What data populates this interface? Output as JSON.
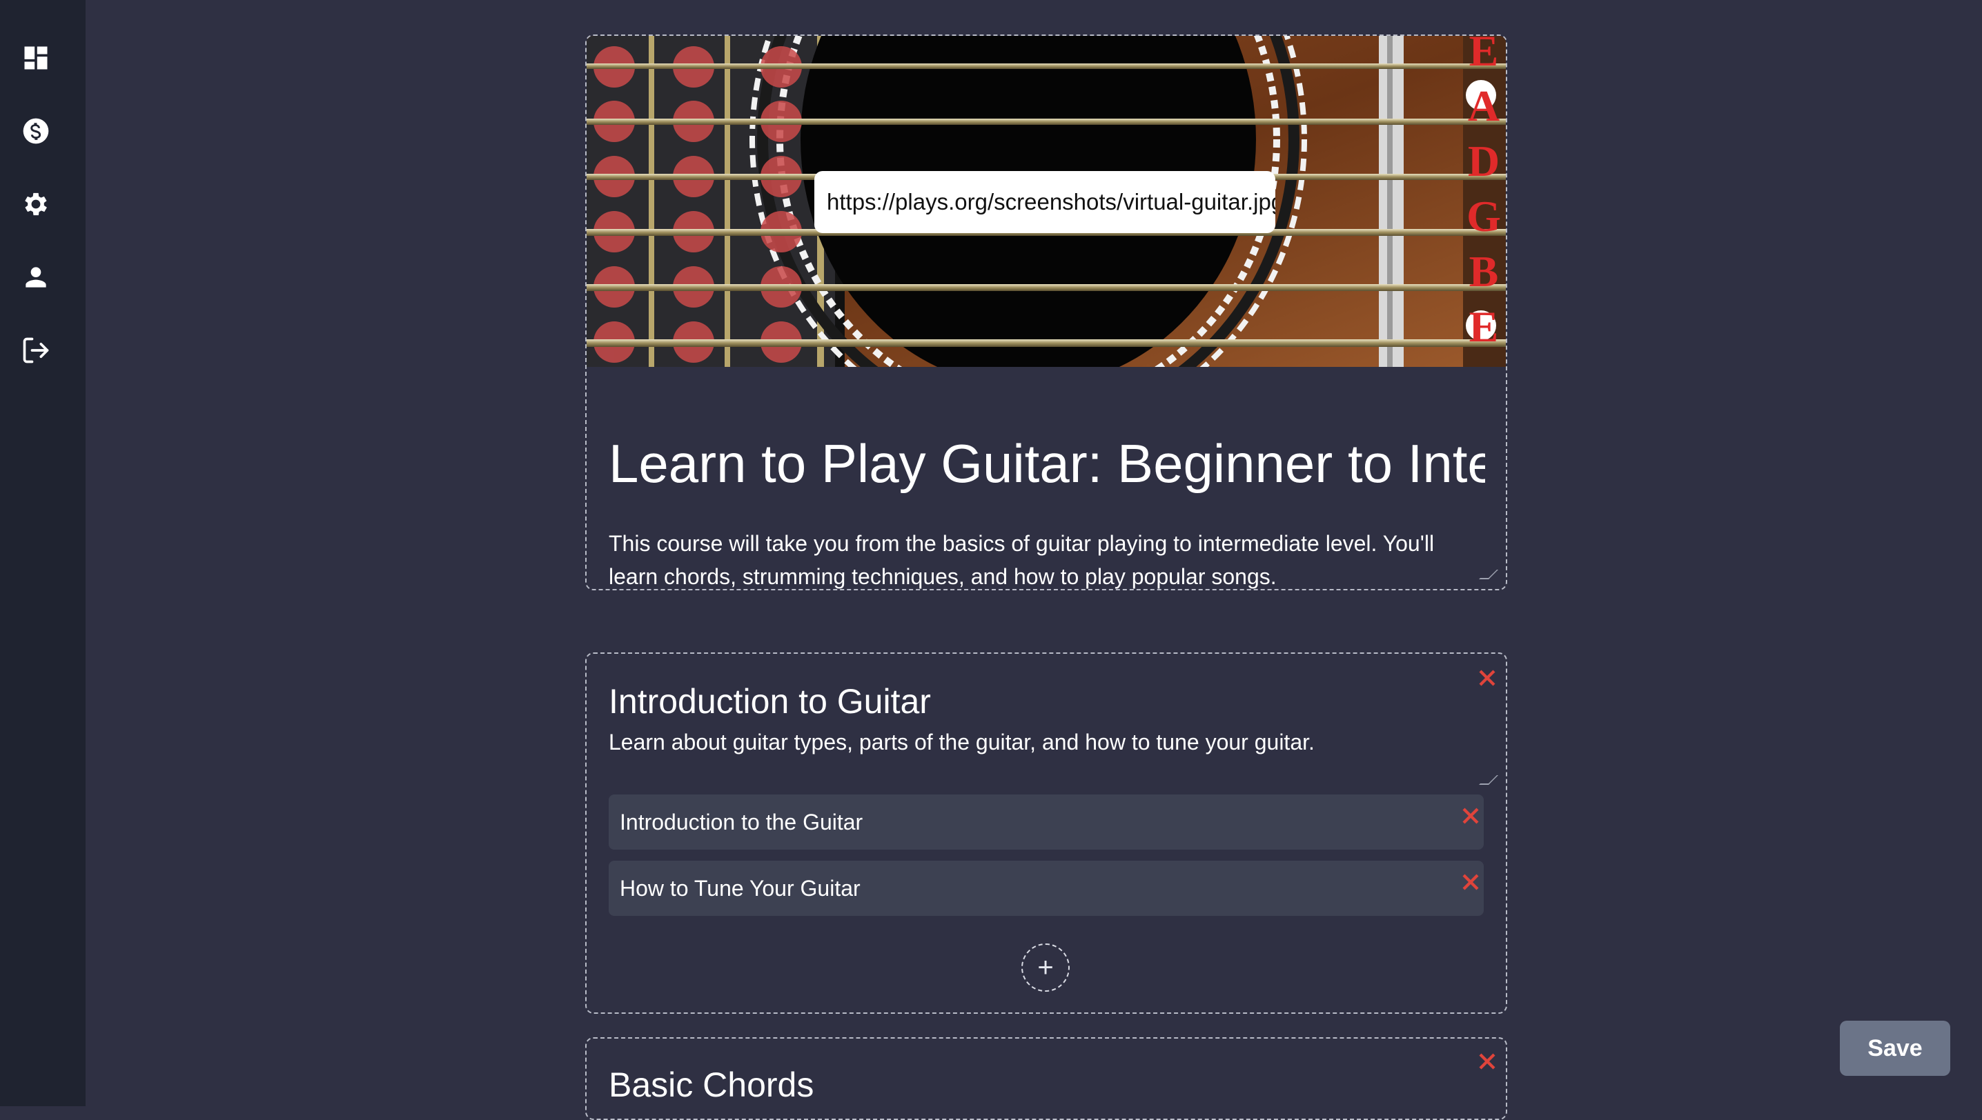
{
  "sidebar": {
    "items": [
      {
        "icon": "dashboard-icon"
      },
      {
        "icon": "dollar-icon"
      },
      {
        "icon": "gear-icon"
      },
      {
        "icon": "user-icon"
      },
      {
        "icon": "logout-icon"
      }
    ]
  },
  "course": {
    "cover_url": "https://plays.org/screenshots/virtual-guitar.jpg",
    "string_labels": [
      "E",
      "A",
      "D",
      "G",
      "B",
      "E"
    ],
    "title": "Learn to Play Guitar: Beginner to Intermediate",
    "description": "This course will take you from the basics of guitar playing to intermediate level. You'll learn chords, strumming techniques, and how to play popular songs."
  },
  "modules": [
    {
      "title": "Introduction to Guitar",
      "description": "Learn about guitar types, parts of the guitar, and how to tune your guitar.",
      "lessons": [
        {
          "title": "Introduction to the Guitar"
        },
        {
          "title": "How to Tune Your Guitar"
        }
      ],
      "add_label": "+"
    },
    {
      "title": "Basic Chords"
    }
  ],
  "actions": {
    "save_label": "Save"
  },
  "colors": {
    "background": "#2f3043",
    "sidebar": "#1f2330",
    "lesson_bg": "#3d4152",
    "delete": "#e0443b",
    "save": "#6b7488",
    "fret_dot": "#c94a4a"
  }
}
